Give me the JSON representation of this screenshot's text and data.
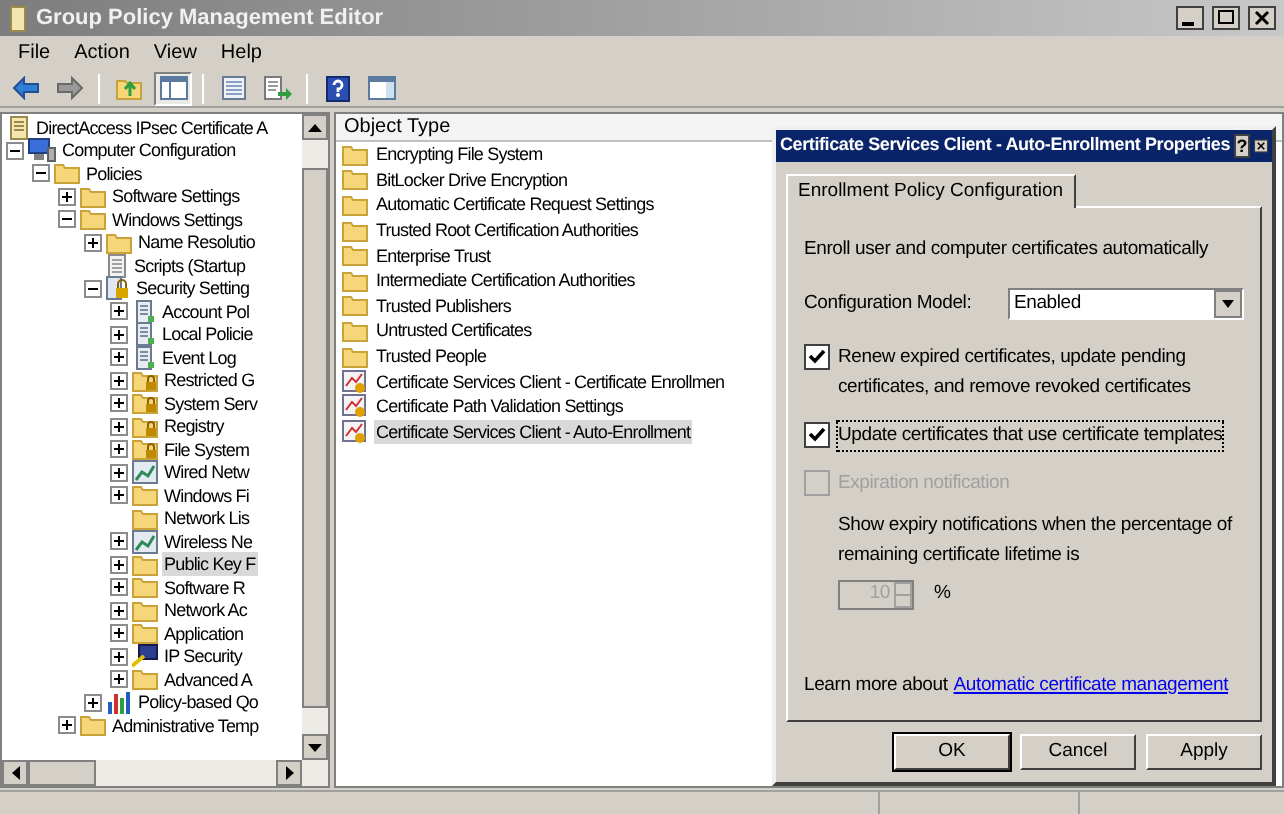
{
  "window": {
    "title": "Group Policy Management Editor"
  },
  "menu": [
    "File",
    "Action",
    "View",
    "Help"
  ],
  "toolbar": [
    [
      {
        "kind": "back",
        "pressed": false
      },
      {
        "kind": "forward",
        "pressed": false
      }
    ],
    [
      {
        "kind": "up",
        "pressed": false
      },
      {
        "kind": "tree",
        "pressed": true
      }
    ],
    [
      {
        "kind": "properties",
        "pressed": false
      },
      {
        "kind": "export",
        "pressed": false
      }
    ],
    [
      {
        "kind": "help",
        "pressed": false
      },
      {
        "kind": "pane",
        "pressed": false
      }
    ]
  ],
  "tree": [
    {
      "label": "DirectAccess IPsec Certificate A",
      "kind": "gpo",
      "selected": false,
      "children": [
        {
          "label": "Computer Configuration",
          "kind": "computer",
          "expandable": true,
          "expanded": true,
          "selected": false,
          "children": [
            {
              "label": "Policies",
              "kind": "folder",
              "expandable": true,
              "expanded": true,
              "selected": false,
              "children": [
                {
                  "label": "Software Settings",
                  "kind": "folder",
                  "expandable": true,
                  "expanded": false,
                  "selected": false
                },
                {
                  "label": "Windows Settings",
                  "kind": "folder",
                  "expandable": true,
                  "expanded": true,
                  "selected": false,
                  "children": [
                    {
                      "label": "Name Resolutio",
                      "kind": "folder",
                      "expandable": true,
                      "expanded": false,
                      "selected": false
                    },
                    {
                      "label": "Scripts (Startup",
                      "kind": "script",
                      "expandable": false,
                      "selected": false
                    },
                    {
                      "label": "Security Setting",
                      "kind": "secure",
                      "expandable": true,
                      "expanded": true,
                      "selected": false,
                      "children": [
                        {
                          "label": "Account Pol",
                          "kind": "policy",
                          "expandable": true,
                          "expanded": false,
                          "selected": false
                        },
                        {
                          "label": "Local Policie",
                          "kind": "policy",
                          "expandable": true,
                          "expanded": false,
                          "selected": false
                        },
                        {
                          "label": "Event Log",
                          "kind": "policy",
                          "expandable": true,
                          "expanded": false,
                          "selected": false
                        },
                        {
                          "label": "Restricted G",
                          "kind": "lockfolder",
                          "expandable": true,
                          "expanded": false,
                          "selected": false
                        },
                        {
                          "label": "System Serv",
                          "kind": "lockfolder",
                          "expandable": true,
                          "expanded": false,
                          "selected": false
                        },
                        {
                          "label": "Registry",
                          "kind": "lockfolder",
                          "expandable": true,
                          "expanded": false,
                          "selected": false
                        },
                        {
                          "label": "File System",
                          "kind": "lockfolder",
                          "expandable": true,
                          "expanded": false,
                          "selected": false
                        },
                        {
                          "label": "Wired Netw",
                          "kind": "network",
                          "expandable": true,
                          "expanded": false,
                          "selected": false
                        },
                        {
                          "label": "Windows Fi",
                          "kind": "folder",
                          "expandable": true,
                          "expanded": false,
                          "selected": false
                        },
                        {
                          "label": "Network Lis",
                          "kind": "folder",
                          "expandable": false,
                          "selected": false
                        },
                        {
                          "label": "Wireless Ne",
                          "kind": "network",
                          "expandable": true,
                          "expanded": false,
                          "selected": false
                        },
                        {
                          "label": "Public Key F",
                          "kind": "folder",
                          "expandable": true,
                          "expanded": false,
                          "selected": true
                        },
                        {
                          "label": "Software R",
                          "kind": "folder",
                          "expandable": true,
                          "expanded": false,
                          "selected": false
                        },
                        {
                          "label": "Network Ac",
                          "kind": "folder",
                          "expandable": true,
                          "expanded": false,
                          "selected": false
                        },
                        {
                          "label": "Application",
                          "kind": "folder",
                          "expandable": true,
                          "expanded": false,
                          "selected": false
                        },
                        {
                          "label": "IP Security",
                          "kind": "ipsec",
                          "expandable": true,
                          "expanded": false,
                          "selected": false
                        },
                        {
                          "label": "Advanced A",
                          "kind": "folder",
                          "expandable": true,
                          "expanded": false,
                          "selected": false
                        }
                      ]
                    },
                    {
                      "label": "Policy-based Qo",
                      "kind": "chart",
                      "expandable": true,
                      "expanded": false,
                      "selected": false
                    }
                  ]
                },
                {
                  "label": "Administrative Temp",
                  "kind": "folder",
                  "expandable": true,
                  "expanded": false,
                  "selected": false
                }
              ]
            }
          ]
        }
      ]
    }
  ],
  "list": {
    "columns": [
      "Object Type"
    ],
    "items": [
      {
        "label": "Encrypting File System",
        "kind": "folder",
        "selected": false
      },
      {
        "label": "BitLocker Drive Encryption",
        "kind": "folder",
        "selected": false
      },
      {
        "label": "Automatic Certificate Request Settings",
        "kind": "folder",
        "selected": false
      },
      {
        "label": "Trusted Root Certification Authorities",
        "kind": "folder",
        "selected": false
      },
      {
        "label": "Enterprise Trust",
        "kind": "folder",
        "selected": false
      },
      {
        "label": "Intermediate Certification Authorities",
        "kind": "folder",
        "selected": false
      },
      {
        "label": "Trusted Publishers",
        "kind": "folder",
        "selected": false
      },
      {
        "label": "Untrusted Certificates",
        "kind": "folder",
        "selected": false
      },
      {
        "label": "Trusted People",
        "kind": "folder",
        "selected": false
      },
      {
        "label": "Certificate Services Client - Certificate Enrollmen",
        "kind": "cert",
        "selected": false
      },
      {
        "label": "Certificate Path Validation Settings",
        "kind": "cert",
        "selected": false
      },
      {
        "label": "Certificate Services Client - Auto-Enrollment",
        "kind": "cert",
        "selected": true
      }
    ]
  },
  "dialog": {
    "title": "Certificate Services Client - Auto-Enrollment Properties",
    "help": "?",
    "tabs": [
      {
        "label": "Enrollment Policy Configuration",
        "selected": true
      }
    ],
    "description": "Enroll user and computer certificates automatically",
    "config_model": {
      "label": "Configuration Model:",
      "value": "Enabled"
    },
    "options": [
      {
        "label": "Renew expired certificates, update pending certificates, and remove revoked certificates",
        "checked": true,
        "disabled": false,
        "focused": false
      },
      {
        "label": "Update certificates that use certificate templates",
        "checked": true,
        "disabled": false,
        "focused": true
      },
      {
        "label": "Expiration notification",
        "checked": false,
        "disabled": true,
        "focused": false
      }
    ],
    "expiry_text": "Show expiry notifications when the percentage of remaining certificate lifetime is",
    "spinner": {
      "value": "10",
      "disabled": true
    },
    "unit": "%",
    "learn_more": {
      "text": "Learn more about",
      "link": "Automatic certificate management"
    },
    "buttons": [
      {
        "label": "OK",
        "default": true
      },
      {
        "label": "Cancel",
        "default": false
      },
      {
        "label": "Apply",
        "default": false
      }
    ]
  }
}
